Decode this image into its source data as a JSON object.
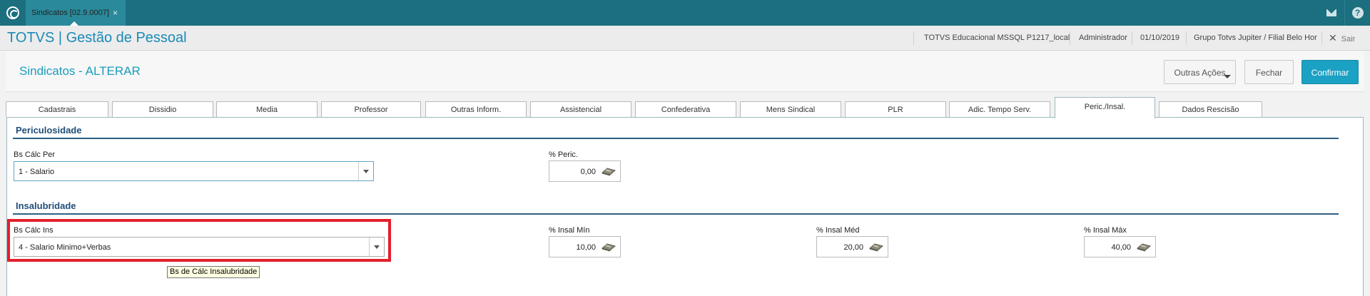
{
  "topbar": {
    "tab_label": "Sindicatos [02.9.0007]",
    "tab_close": "×",
    "icons": [
      "mail-icon",
      "help-icon"
    ],
    "help_glyph": "?"
  },
  "app": {
    "title": "TOTVS | Gestão de Pessoal",
    "environment": "TOTVS Educacional MSSQL P1217_local",
    "user": "Administrador",
    "date": "01/10/2019",
    "branch": "Grupo Totvs Jupiter / Filial Belo Hor",
    "exit_icon": "✕",
    "exit": "Sair"
  },
  "form": {
    "title": "Sindicatos - ALTERAR",
    "buttons": {
      "other_actions": "Outras Ações",
      "close": "Fechar",
      "confirm": "Confirmar"
    }
  },
  "tabs": [
    "Cadastrais",
    "Dissidio",
    "Media",
    "Professor",
    "Outras Inform.",
    "Assistencial",
    "Confederativa",
    "Mens Sindical",
    "PLR",
    "Adic. Tempo Serv.",
    "Peric./Insal.",
    "Dados Rescisão"
  ],
  "active_tab": "Peric./Insal.",
  "periculosidade": {
    "title": "Periculosidade",
    "bs_calc_label": "Bs Cálc Per",
    "bs_calc_value": "1 - Salario",
    "pct_label": "% Peric.",
    "pct_value": "0,00"
  },
  "insalubridade": {
    "title": "Insalubridade",
    "bs_calc_label": "Bs Cálc Ins",
    "bs_calc_value": "4 - Salario Minimo+Verbas",
    "min_label": "% Insal Mín",
    "min_value": "10,00",
    "med_label": "% Insal Méd",
    "med_value": "20,00",
    "max_label": "% Insal Máx",
    "max_value": "40,00"
  },
  "tooltip": "Bs de Cálc Insalubridade",
  "colors": {
    "topbar": "#1b6f7f",
    "accent": "#1ba1c4",
    "highlight": "#e2202c"
  }
}
